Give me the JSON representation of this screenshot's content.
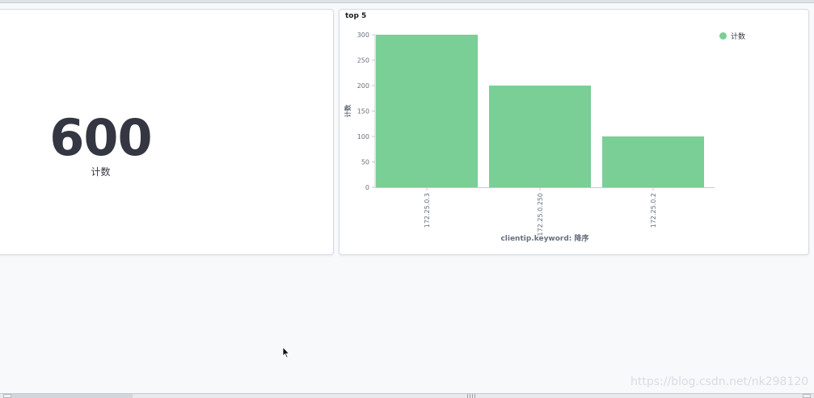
{
  "metric": {
    "value": "600",
    "label": "计数"
  },
  "chart_panel": {
    "title": "top 5"
  },
  "chart_data": {
    "type": "bar",
    "categories": [
      "172.25.0.3",
      "172.25.0.250",
      "172.25.0.2"
    ],
    "series": [
      {
        "name": "计数",
        "values": [
          300,
          200,
          100
        ]
      }
    ],
    "ylabel": "计数",
    "xlabel": "clientip.keyword: 降序",
    "yticks": [
      0,
      50,
      100,
      150,
      200,
      250,
      300
    ],
    "ylim": [
      0,
      300
    ],
    "legend_position": "top-right",
    "bar_color": "#79cf96",
    "grid": false
  },
  "watermark": "https://blog.csdn.net/nk298120",
  "icons": {
    "cursor": "mouse-pointer-icon"
  }
}
